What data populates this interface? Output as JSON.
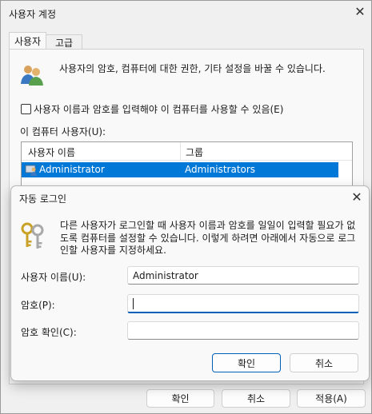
{
  "outer_window": {
    "title": "사용자 계정",
    "tabs": [
      "사용자",
      "고급"
    ],
    "intro_text": "사용자의 암호, 컴퓨터에 대한 권한, 기타 설정을 바꿀 수 있습니다.",
    "checkbox_label": "사용자 이름과 암호를 입력해야 이 컴퓨터를 사용할 수 있음(E)",
    "checkbox_checked": false,
    "users_label": "이 컴퓨터 사용자(U):",
    "table": {
      "columns": [
        "사용자 이름",
        "그룹"
      ],
      "rows": [
        {
          "name": "Administrator",
          "group": "Administrators",
          "selected": true
        }
      ]
    },
    "buttons": {
      "ok": "확인",
      "cancel": "취소",
      "apply": "적용(A)"
    }
  },
  "dialog": {
    "title": "자동 로그인",
    "description": "다른 사용자가 로그인할 때 사용자 이름과 암호를 일일이 입력할 필요가 없도록 컴퓨터를 설정할 수 있습니다. 이렇게 하려면 아래에서 자동으로 로그인할 사용자를 지정하세요.",
    "fields": {
      "username_label": "사용자 이름(U):",
      "username_value": "Administrator",
      "password_label": "암호(P):",
      "password_value": "",
      "confirm_label": "암호 확인(C):",
      "confirm_value": ""
    },
    "buttons": {
      "ok": "확인",
      "cancel": "취소"
    }
  },
  "colors": {
    "accent": "#005fb8",
    "selection": "#0078d7"
  },
  "icons": [
    "users-icon",
    "keys-icon",
    "user-row-icon",
    "close-icon"
  ]
}
